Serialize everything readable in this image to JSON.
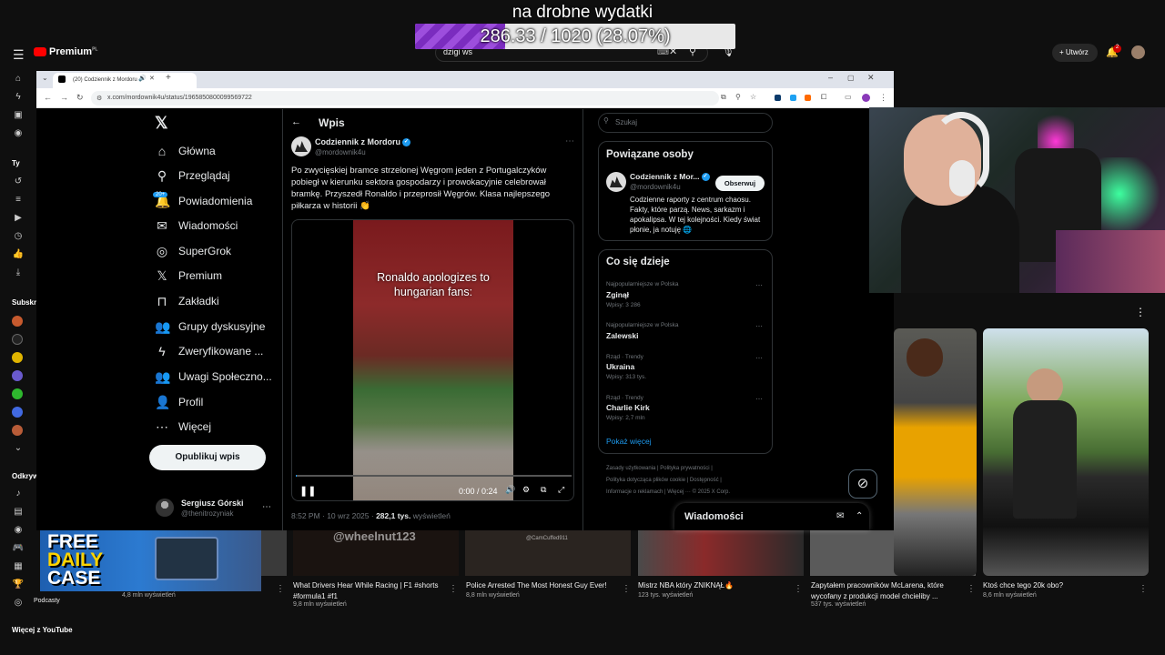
{
  "overlay": {
    "goal_text": "na drobne wydatki",
    "goal_value": "286.33 / 1020 (28.07%)",
    "goal_fraction": 0.2807,
    "fill_color": "#7b2cbf"
  },
  "youtube": {
    "logo": "Premium",
    "logo_sup": "PL",
    "search_value": "dzigi ws",
    "create_label": "Utwórz",
    "notif_count": "2",
    "sidebar": {
      "section_you": "Ty",
      "section_subs": "Subskr",
      "section_explore": "Odkryw",
      "podcasts": "Podcasty",
      "more": "Więcej z YouTube"
    },
    "watermark_1": "@wheelnut123",
    "watermark_2": "@CamCuffed911",
    "free_case_line1": "FREE",
    "free_case_line2": "DAILY",
    "free_case_line3": "CASE",
    "videos": [
      {
        "title": "",
        "meta": "4,8 mln wyświetleń"
      },
      {
        "title": "What Drivers Hear While Racing | F1 #shorts #formula1 #f1",
        "meta": "9,8 mln wyświetleń"
      },
      {
        "title": "Police Arrested The Most Honest Guy Ever!",
        "meta": "8,8 mln wyświetleń"
      },
      {
        "title": "Mistrz NBA który ZNIKNĄŁ🔥",
        "meta": "123 tys. wyświetleń"
      },
      {
        "title": "Zapytałem pracowników McLarena, które wycofany z produkcji model chcieliby ...",
        "meta": "537 tys. wyświetleń"
      },
      {
        "title": "Ktoś chce tego 20k obo?",
        "meta": "8,6 mln wyświetleń"
      }
    ]
  },
  "browser": {
    "tab_title": "(20) Codziennik z Mordoru",
    "url": "x.com/mordownik4u/status/1965850800099569722"
  },
  "x": {
    "nav": [
      {
        "icon": "⌂",
        "label": "Główna"
      },
      {
        "icon": "⚲",
        "label": "Przeglądaj"
      },
      {
        "icon": "🔔",
        "label": "Powiadomienia"
      },
      {
        "icon": "✉",
        "label": "Wiadomości"
      },
      {
        "icon": "◎",
        "label": "SuperGrok"
      },
      {
        "icon": "𝕏",
        "label": "Premium"
      },
      {
        "icon": "⊓",
        "label": "Zakładki"
      },
      {
        "icon": "👥",
        "label": "Grupy dyskusyjne"
      },
      {
        "icon": "ϟ",
        "label": "Zweryfikowane ..."
      },
      {
        "icon": "👥",
        "label": "Uwagi Społeczno..."
      },
      {
        "icon": "👤",
        "label": "Profil"
      },
      {
        "icon": "⋯",
        "label": "Więcej"
      }
    ],
    "notif_badge": "20+",
    "post_button": "Opublikuj wpis",
    "user": {
      "name": "Sergiusz Górski",
      "handle": "@thenitrozyniak"
    },
    "page_title": "Wpis",
    "tweet": {
      "author": "Codziennik z Mordoru",
      "handle": "@mordownik4u",
      "text": "Po zwycięskiej bramce strzelonej Węgrom jeden z Portugalczyków pobiegł w kierunku sektora gospodarzy i prowokacyjnie celebrował bramkę. Przyszedł Ronaldo i przeprosił Węgrów. Klasa najlepszego piłkarza w historii 👏",
      "video_caption": "Ronaldo apologizes to hungarian fans:",
      "video_time": "0:00 / 0:24",
      "video_progress": 0.0,
      "date": "8:52 PM · 10 wrz 2025 · ",
      "views_count": "282,1 tys.",
      "views_label": " wyświetleń"
    },
    "search_placeholder": "Szukaj",
    "related": {
      "title": "Powiązane osoby",
      "name": "Codziennik z Mor...",
      "handle": "@mordownik4u",
      "follow": "Obserwuj",
      "bio": "Codzienne raporty z centrum chaosu. Fakty, które parzą. News, sarkazm i apokalipsa. W tej kolejności. Kiedy świat płonie, ja notuję 🌐"
    },
    "trends": {
      "title": "Co się dzieje",
      "items": [
        {
          "meta": "Najpopularniejsze w Polska",
          "name": "Zginął",
          "count": "Wpisy: 3 286"
        },
        {
          "meta": "Najpopularniejsze w Polska",
          "name": "Zalewski",
          "count": ""
        },
        {
          "meta": "Rząd · Trendy",
          "name": "Ukraina",
          "count": "Wpisy: 313 tys."
        },
        {
          "meta": "Rząd · Trendy",
          "name": "Charlie Kirk",
          "count": "Wpisy: 2,7 mln"
        }
      ],
      "show_more": "Pokaż więcej"
    },
    "footer": {
      "line1": "Zasady użytkowania  |  Polityka prywatności  |",
      "line2": "Polityka dotycząca plików cookie  |  Dostępność  |",
      "line3": "Informacje o reklamach  |  Więcej ···  © 2025 X Corp."
    },
    "messages_title": "Wiadomości"
  }
}
